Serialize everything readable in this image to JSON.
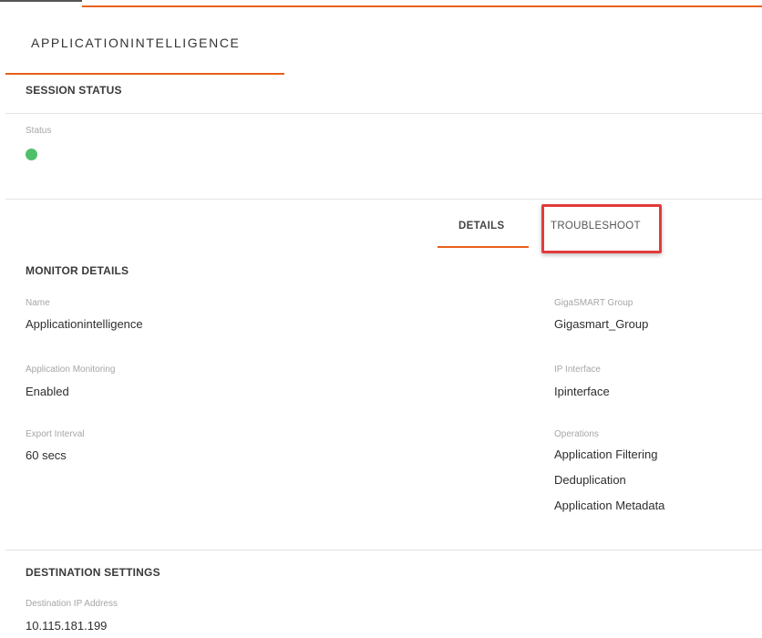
{
  "header": {
    "app_tab_label": "APPLICATIONINTELLIGENCE"
  },
  "session_status": {
    "title": "SESSION STATUS",
    "status_label": "Status",
    "status_color": "#4fbf6a"
  },
  "subtabs": {
    "details": "DETAILS",
    "troubleshoot": "TROUBLESHOOT",
    "highlight_color": "#e23b3b",
    "accent_color": "#e8601c"
  },
  "monitor_details": {
    "title": "MONITOR DETAILS",
    "name_label": "Name",
    "name_value": "Applicationintelligence",
    "app_monitoring_label": "Application Monitoring",
    "app_monitoring_value": "Enabled",
    "export_interval_label": "Export Interval",
    "export_interval_value": "60 secs",
    "gigasmart_group_label": "GigaSMART Group",
    "gigasmart_group_value": "Gigasmart_Group",
    "ip_interface_label": "IP Interface",
    "ip_interface_value": "Ipinterface",
    "operations_label": "Operations",
    "operations": [
      "Application Filtering",
      "Deduplication",
      "Application Metadata"
    ]
  },
  "destination_settings": {
    "title": "DESTINATION SETTINGS",
    "dest_ip_label": "Destination IP Address",
    "dest_ip_value": "10.115.181.199"
  }
}
